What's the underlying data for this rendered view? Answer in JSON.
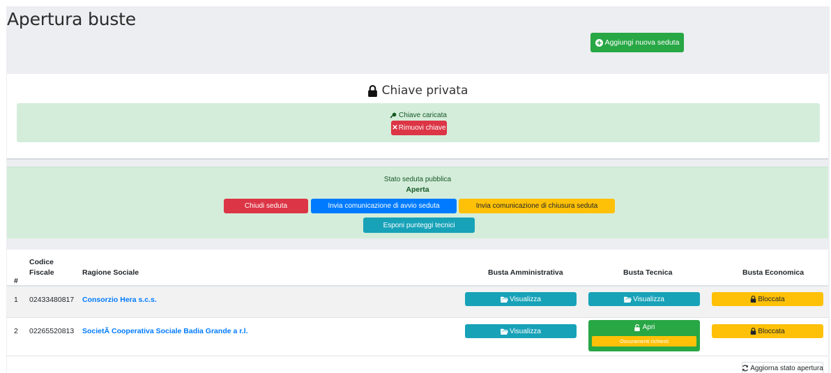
{
  "header": {
    "title": "Apertura buste",
    "add_button_label": "Aggiungi nuova seduta"
  },
  "key_card": {
    "title": "Chiave privata",
    "loaded_label": "Chiave caricata",
    "remove_label": "Rimuovi chiave"
  },
  "session": {
    "state_label": "Stato seduta pubblica",
    "state_value": "Aperta",
    "close_label": "Chiudi seduta",
    "start_comm_label": "Invia comunicazione di avvio seduta",
    "end_comm_label": "Invia comunicazione di chiusura seduta",
    "expose_label": "Esponi punteggi tecnici"
  },
  "table": {
    "headers": {
      "index": "#",
      "fiscal_code_1": "Codice",
      "fiscal_code_2": "Fiscale",
      "company": "Ragione Sociale",
      "admin": "Busta Amministrativa",
      "tech": "Busta Tecnica",
      "econ": "Busta Economica"
    },
    "rows": [
      {
        "index": "1",
        "fiscal_code": "02433480817",
        "company": "Consorzio Hera s.c.s.",
        "admin_label": "Visualizza",
        "tech_label": "Visualizza",
        "econ_label": "Bloccata"
      },
      {
        "index": "2",
        "fiscal_code": "02265520813",
        "company": "SocietÃ  Cooperativa Sociale Badia Grande a r.l.",
        "admin_label": "Visualizza",
        "tech_label": "Apri",
        "tech_note": "Oscuramenti richiesti",
        "econ_label": "Bloccata"
      }
    ],
    "refresh_label": "Aggiorna stato apertura"
  },
  "colors": {
    "success": "#28a745",
    "danger": "#dc3545",
    "primary": "#007bff",
    "warning": "#ffc107",
    "info": "#17a2b8",
    "alert_bg": "#d4edda"
  },
  "icons": [
    "plus-circle-icon",
    "lock-icon",
    "key-icon",
    "times-icon",
    "folder-open-icon",
    "unlock-icon",
    "sync-icon"
  ]
}
